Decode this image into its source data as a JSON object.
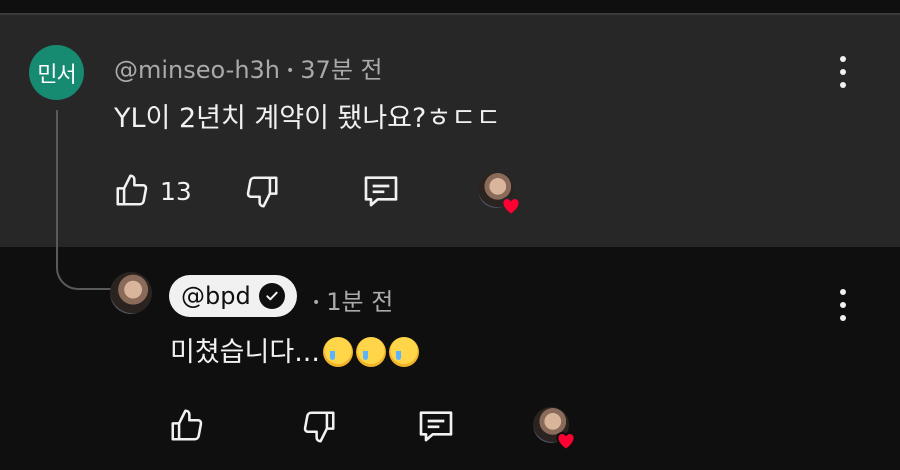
{
  "top_comment": {
    "avatar_initials": "민서",
    "handle": "@minseo-h3h",
    "separator": "•",
    "time": "37분 전",
    "text": "YL이 2년치 계약이 됐나요?ㅎㄷㄷ",
    "like_count": "13"
  },
  "reply": {
    "handle": "@bpd",
    "separator": "•",
    "time": "1분 전",
    "text": "미쳤습니다...",
    "emoji_count": 3
  },
  "icons": {
    "like": "thumbs-up-icon",
    "dislike": "thumbs-down-icon",
    "reply": "comment-icon",
    "more": "vertical-dots-icon",
    "verified": "check-badge-icon",
    "creator_heart": "heart-icon"
  },
  "colors": {
    "background": "#0f0f0f",
    "comment_highlight": "#272727",
    "avatar_green": "#178a72",
    "heart_red": "#ff0033"
  }
}
